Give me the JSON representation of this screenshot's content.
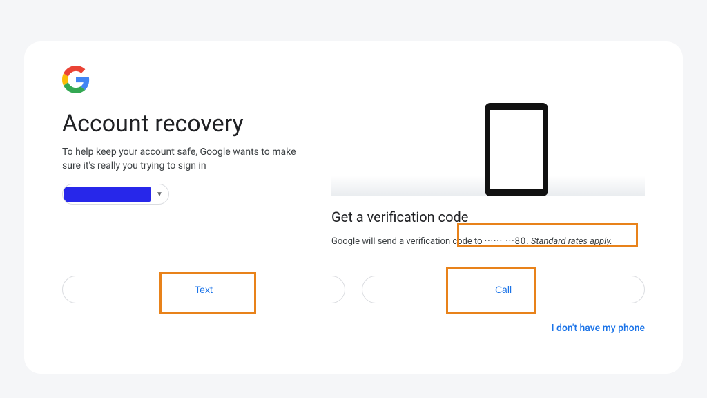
{
  "heading": "Account recovery",
  "subtitle": "To help keep your account safe, Google wants to make sure it's really you trying to sign in",
  "verification": {
    "title": "Get a verification code",
    "text_prefix": "Google will send a verification code to ",
    "masked_number": "······ ···80",
    "text_suffix": ". ",
    "rates": "Standard rates apply."
  },
  "buttons": {
    "text": "Text",
    "call": "Call"
  },
  "alt_link": "I don't have my phone"
}
